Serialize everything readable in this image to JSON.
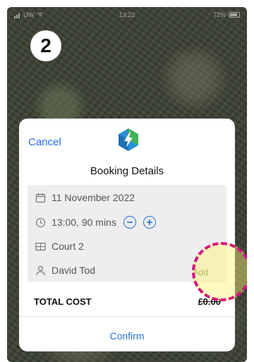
{
  "step_number": "2",
  "status_bar": {
    "carrier": "UW",
    "time": "13:22",
    "battery": "72%"
  },
  "booking": {
    "cancel_label": "Cancel",
    "title": "Booking Details",
    "date": "11 November 2022",
    "time": "13:00, 90 mins",
    "court": "Court 2",
    "player": "David Tod",
    "add_label": "Add",
    "total_label": "TOTAL COST",
    "total_value": "£0.00",
    "confirm_label": "Confirm"
  },
  "colors": {
    "accent": "#2a6fdb",
    "highlight_border": "#d6157c",
    "add_text": "#6b8f3c"
  }
}
